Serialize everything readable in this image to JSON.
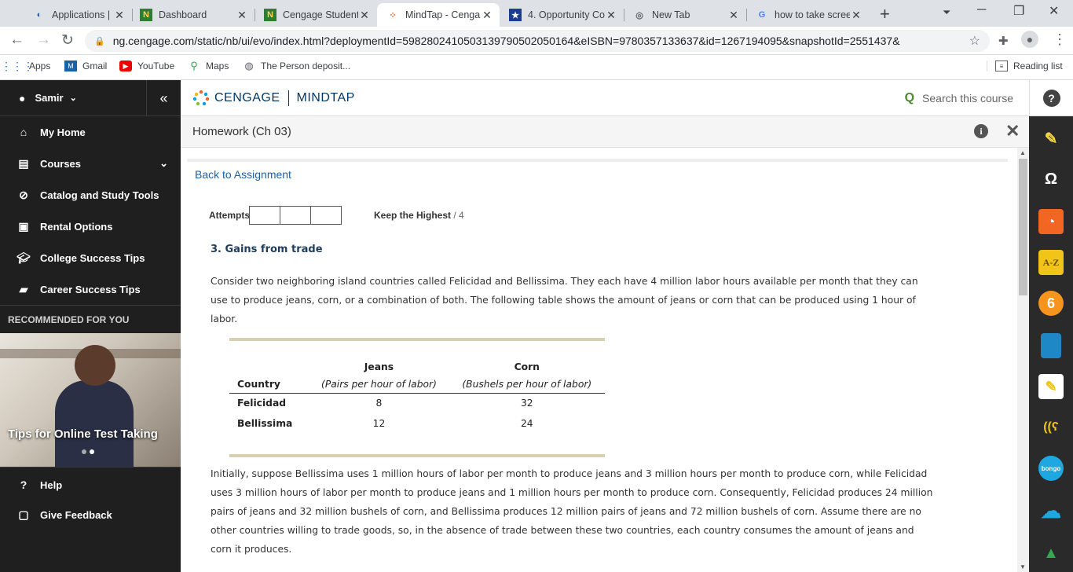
{
  "browser": {
    "tabs": [
      {
        "title": "Applications | Rap",
        "icon": "applications-favicon"
      },
      {
        "title": "Dashboard",
        "icon": "n-favicon"
      },
      {
        "title": "Cengage Student",
        "icon": "n-favicon"
      },
      {
        "title": "MindTap - Cenga",
        "icon": "mindtap-favicon"
      },
      {
        "title": "4. Opportunity Co",
        "icon": "star-favicon"
      },
      {
        "title": "New Tab",
        "icon": "chrome-favicon"
      },
      {
        "title": "how to take scree",
        "icon": "google-favicon"
      }
    ],
    "url": "ng.cengage.com/static/nb/ui/evo/index.html?deploymentId=5982802410503139790502050164&eISBN=9780357133637&id=1267194095&snapshotId=2551437&",
    "bookmarks": [
      {
        "label": "Apps",
        "icon": "apps-grid-icon"
      },
      {
        "label": "Gmail",
        "icon": "gmail-icon"
      },
      {
        "label": "YouTube",
        "icon": "youtube-icon"
      },
      {
        "label": "Maps",
        "icon": "maps-icon"
      },
      {
        "label": "The Person deposit...",
        "icon": "globe-icon"
      }
    ],
    "reading_list": "Reading list"
  },
  "sidebar": {
    "user": "Samir",
    "items": [
      {
        "label": "My Home",
        "icon": "home-icon"
      },
      {
        "label": "Courses",
        "icon": "book-icon"
      },
      {
        "label": "Catalog and Study Tools",
        "icon": "compass-icon"
      },
      {
        "label": "Rental Options",
        "icon": "rental-icon"
      },
      {
        "label": "College Success Tips",
        "icon": "graduation-cap-icon"
      },
      {
        "label": "Career Success Tips",
        "icon": "briefcase-icon"
      }
    ],
    "recommended_heading": "RECOMMENDED FOR YOU",
    "promo_title": "Tips for Online Test Taking",
    "bottom": [
      {
        "label": "Help",
        "icon": "help-circle-icon"
      },
      {
        "label": "Give Feedback",
        "icon": "feedback-icon"
      }
    ]
  },
  "header": {
    "brand": "CENGAGE",
    "product": "MINDTAP",
    "search_placeholder": "Search this course"
  },
  "assignment": {
    "title": "Homework (Ch 03)",
    "back_link": "Back to Assignment",
    "attempts_label": "Attempts",
    "keep_label": "Keep the Highest",
    "keep_suffix": "/ 4",
    "question_title": "3. Gains from trade",
    "intro": "Consider two neighboring island countries called Felicidad and Bellissima. They each have 4 million labor hours available per month that they can use to produce jeans, corn, or a combination of both. The following table shows the amount of jeans or corn that can be produced using 1 hour of labor.",
    "table": {
      "col_country": "Country",
      "col_jeans": "Jeans",
      "col_jeans_unit": "(Pairs per hour of labor)",
      "col_corn": "Corn",
      "col_corn_unit": "(Bushels per hour of labor)",
      "rows": [
        {
          "country": "Felicidad",
          "jeans": "8",
          "corn": "32"
        },
        {
          "country": "Bellissima",
          "jeans": "12",
          "corn": "24"
        }
      ]
    },
    "para2": "Initially, suppose Bellissima uses 1 million hours of labor per month to produce jeans and 3 million hours per month to produce corn, while Felicidad uses 3 million hours of labor per month to produce jeans and 1 million hours per month to produce corn. Consequently, Felicidad produces 24 million pairs of jeans and 32 million bushels of corn, and Bellissima produces 12 million pairs of jeans and 72 million bushels of corn. Assume there are no other countries willing to trade goods, so, in the absence of trade between these two countries, each country consumes the amount of jeans and corn it produces."
  },
  "dock": [
    {
      "name": "highlighter-icon",
      "color": "#f5d547"
    },
    {
      "name": "headphones-icon",
      "color": "#2a2a2a"
    },
    {
      "name": "rss-icon",
      "color": "#f26522"
    },
    {
      "name": "dictionary-icon",
      "color": "#f0c419"
    },
    {
      "name": "cengage-6-icon",
      "color": "#f7941d"
    },
    {
      "name": "notebook-icon",
      "color": "#1e88c7"
    },
    {
      "name": "notes-icon",
      "color": "#ffffff"
    },
    {
      "name": "readspeaker-icon",
      "color": "#2a2a2a"
    },
    {
      "name": "bongo-icon",
      "color": "#1ea7e1"
    },
    {
      "name": "cloud-icon",
      "color": "#1ea7e1"
    },
    {
      "name": "drive-icon",
      "color": "#2a2a2a"
    }
  ]
}
